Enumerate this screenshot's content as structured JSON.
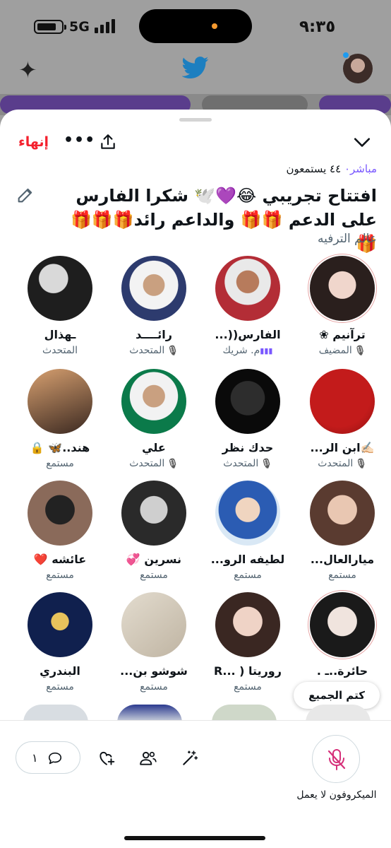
{
  "status_bar": {
    "network": "5G",
    "time": "٩:٣٥"
  },
  "space": {
    "end_label": "إنهاء",
    "more_label": "•••",
    "live_label": "مباشر",
    "listeners": "٤٤ يستمعون",
    "title": "افتتاح تجريبي 😂💜🕊️ شكرا الفارس على الدعم 🎁🎁 والداعم رائد🎁🎁🎁🎁",
    "community": "عالم الترفيه"
  },
  "participants": [
    {
      "name": "ترآنيم ❀",
      "role": "المضيف",
      "mic": "off"
    },
    {
      "name": "الفارس((...",
      "role": "م. شريك",
      "mic": "wave"
    },
    {
      "name": "رائــــد",
      "role": "المتحدث",
      "mic": "off"
    },
    {
      "name": "ـهذال",
      "role": "المتحدث",
      "mic": "none"
    },
    {
      "name": "✍🏻ابن الر...",
      "role": "المتحدث",
      "mic": "off"
    },
    {
      "name": "حدك نظر",
      "role": "المتحدث",
      "mic": "off"
    },
    {
      "name": "علي",
      "role": "المتحدث",
      "mic": "off"
    },
    {
      "name": "هند..🦋 🔒",
      "role": "مستمع",
      "mic": "none"
    },
    {
      "name": "ميارالعال...",
      "role": "مستمع",
      "mic": "none"
    },
    {
      "name": "لطيفه الرو...",
      "role": "مستمع",
      "mic": "none"
    },
    {
      "name": "نسرين 💞",
      "role": "مستمع",
      "mic": "none"
    },
    {
      "name": "عائشه ❤️",
      "role": "مستمع",
      "mic": "none"
    },
    {
      "name": "حائرة..ـ .",
      "role": "مستمع",
      "mic": "none"
    },
    {
      "name": "روريتا ( ...R",
      "role": "مستمع",
      "mic": "none"
    },
    {
      "name": "شوشو بن...",
      "role": "مستمع",
      "mic": "none"
    },
    {
      "name": "البندري",
      "role": "مستمع",
      "mic": "none"
    }
  ],
  "mute_all_label": "كتم الجميع",
  "bottom": {
    "comment_count": "١",
    "mic_status": "الميكروفون لا يعمل"
  },
  "colors": {
    "accent_purple": "#7856ff",
    "end_red": "#f4212e",
    "mic_pink": "#d6307a",
    "twitter_blue": "#1d9bf0"
  }
}
